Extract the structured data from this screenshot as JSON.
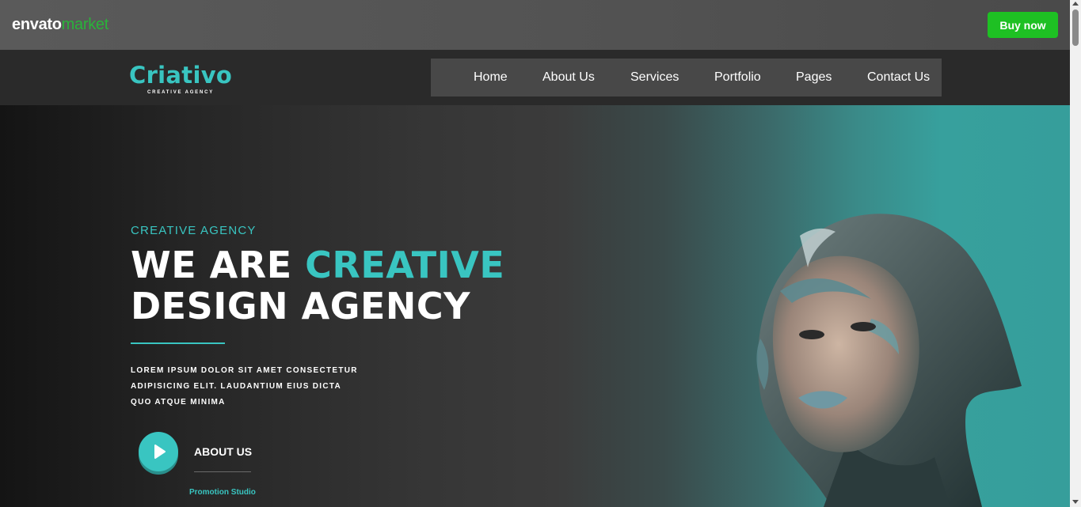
{
  "envato": {
    "logo_primary": "envato",
    "logo_secondary": "market",
    "buy_label": "Buy now",
    "accent": "#1ec023"
  },
  "site": {
    "brand_name": "Criativo",
    "brand_tagline": "CREATIVE AGENCY",
    "accent": "#39c5c1",
    "nav": [
      {
        "label": "Home"
      },
      {
        "label": "About Us"
      },
      {
        "label": "Services"
      },
      {
        "label": "Portfolio"
      },
      {
        "label": "Pages"
      },
      {
        "label": "Contact Us"
      }
    ]
  },
  "hero": {
    "eyebrow": "CREATIVE AGENCY",
    "title_part1": "WE ARE ",
    "title_accent": "CREATIVE",
    "title_line2": "DESIGN AGENCY",
    "description_line1": "LOREM IPSUM DOLOR SIT AMET CONSECTETUR",
    "description_line2": "ADIPISICING ELIT. LAUDANTIUM EIUS DICTA",
    "description_line3": "QUO ATQUE MINIMA",
    "about_label": "ABOUT US",
    "studio_label": "Promotion Studio",
    "play_icon": "play-icon"
  }
}
